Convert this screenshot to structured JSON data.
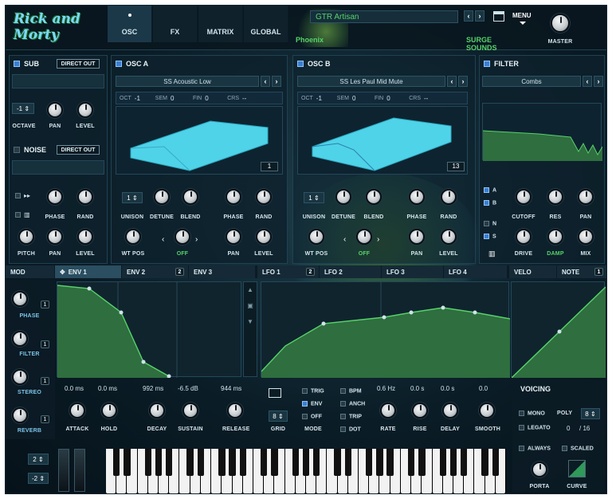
{
  "logo": "Rick and Morty",
  "top_tabs": [
    "OSC",
    "FX",
    "MATRIX",
    "GLOBAL"
  ],
  "patch": {
    "name": "GTR Artisan",
    "category": "Phoenix",
    "author": "SURGE SOUNDS"
  },
  "menu_label": "MENU",
  "master_label": "MASTER",
  "sub": {
    "title": "SUB",
    "direct_out": "DIRECT OUT",
    "octave_value": "-1",
    "labels": [
      "OCTAVE",
      "PAN",
      "LEVEL"
    ]
  },
  "noise": {
    "title": "NOISE",
    "direct_out": "DIRECT OUT",
    "labels": [
      "PHASE",
      "RAND",
      "PITCH",
      "PAN",
      "LEVEL"
    ]
  },
  "osc_a": {
    "title": "OSC A",
    "wavetable": "SS Acoustic Low",
    "params": [
      {
        "k": "OCT",
        "v": "-1"
      },
      {
        "k": "SEM",
        "v": "0"
      },
      {
        "k": "FIN",
        "v": "0"
      },
      {
        "k": "CRS",
        "v": "--"
      }
    ],
    "frame": "1",
    "unison_value": "1",
    "labels_row1": [
      "UNISON",
      "DETUNE",
      "BLEND",
      "PHASE",
      "RAND"
    ],
    "labels_row2": [
      "WT POS",
      "OFF",
      "PAN",
      "LEVEL"
    ]
  },
  "osc_b": {
    "title": "OSC B",
    "wavetable": "SS Les Paul Mid Mute",
    "params": [
      {
        "k": "OCT",
        "v": "-1"
      },
      {
        "k": "SEM",
        "v": "0"
      },
      {
        "k": "FIN",
        "v": "0"
      },
      {
        "k": "CRS",
        "v": "--"
      }
    ],
    "frame": "13",
    "unison_value": "1",
    "labels_row1": [
      "UNISON",
      "DETUNE",
      "BLEND",
      "PHASE",
      "RAND"
    ],
    "labels_row2": [
      "WT POS",
      "OFF",
      "PAN",
      "LEVEL"
    ]
  },
  "filter": {
    "title": "FILTER",
    "type": "Combs",
    "routes": [
      "A",
      "B",
      "N",
      "S"
    ],
    "labels_row1": [
      "CUTOFF",
      "RES",
      "PAN"
    ],
    "labels_row2": [
      "DRIVE",
      "DAMP",
      "MIX"
    ]
  },
  "mod_tabs": [
    {
      "label": "MOD",
      "badge": ""
    },
    {
      "label": "ENV 1",
      "badge": ""
    },
    {
      "label": "ENV 2",
      "badge": "2"
    },
    {
      "label": "ENV 3",
      "badge": ""
    },
    {
      "label": "LFO 1",
      "badge": "2"
    },
    {
      "label": "LFO 2",
      "badge": ""
    },
    {
      "label": "LFO 3",
      "badge": ""
    },
    {
      "label": "LFO 4",
      "badge": ""
    },
    {
      "label": "VELO",
      "badge": ""
    },
    {
      "label": "NOTE",
      "badge": "1"
    }
  ],
  "mod_sources": [
    {
      "label": "PHASE",
      "badge": "1"
    },
    {
      "label": "FILTER",
      "badge": "1"
    },
    {
      "label": "STEREO",
      "badge": "1"
    },
    {
      "label": "REVERB",
      "badge": "1"
    }
  ],
  "env": {
    "params": [
      {
        "label": "ATTACK",
        "value": "0.0 ms"
      },
      {
        "label": "HOLD",
        "value": "0.0 ms"
      },
      {
        "label": "DECAY",
        "value": "992 ms"
      },
      {
        "label": "SUSTAIN",
        "value": "-6.5 dB"
      },
      {
        "label": "RELEASE",
        "value": "944 ms"
      }
    ],
    "grid_label": "GRID",
    "grid_value": "8"
  },
  "lfo": {
    "modes": [
      {
        "label": "TRIG",
        "on": false
      },
      {
        "label": "ENV",
        "on": true
      },
      {
        "label": "OFF",
        "on": false
      }
    ],
    "mode_label": "MODE",
    "opts": [
      "BPM",
      "ANCH",
      "TRIP",
      "DOT"
    ],
    "params": [
      {
        "label": "RATE",
        "value": "0.6 Hz"
      },
      {
        "label": "RISE",
        "value": "0.0 s"
      },
      {
        "label": "DELAY",
        "value": "0.0 s"
      },
      {
        "label": "SMOOTH",
        "value": "0.0"
      }
    ]
  },
  "voicing": {
    "title": "VOICING",
    "mono": "MONO",
    "poly": "POLY",
    "poly_value": "8",
    "legato": "LEGATO",
    "count": "0",
    "max": "/ 16",
    "always": "ALWAYS",
    "scaled": "SCALED",
    "porta": "PORTA",
    "curve": "CURVE"
  },
  "keyboard": {
    "octave_value": "2",
    "transpose_value": "-2"
  },
  "colors": {
    "accent": "#57d36a",
    "wave": "#4fd3e8",
    "curve_fill": "#2f6e3f"
  }
}
